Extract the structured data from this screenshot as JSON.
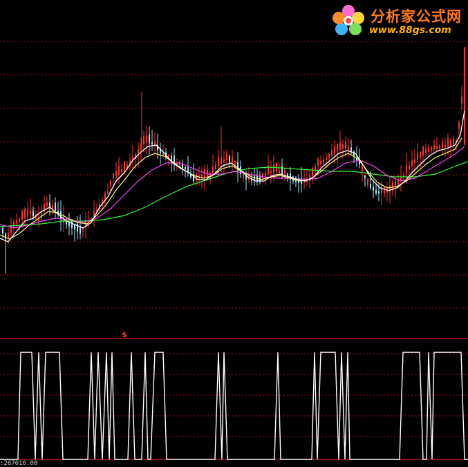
{
  "logo": {
    "name": "分析家公式网",
    "url": "www.88gs.com"
  },
  "footer": {
    "date_label": ":267016.00"
  },
  "marker": {
    "symbol": "$"
  },
  "colors": {
    "background": "#000000",
    "grid": "#a01010",
    "up_candle": "#ff3030",
    "down_candle": "#9fe8ff",
    "ma_short": "#ffffff",
    "ma_mid": "#ffff66",
    "ma_long": "#ff40ff",
    "ma_longest": "#30ff30",
    "signal": "#ffffff",
    "separator": "#ff2020"
  },
  "chart_data": [
    {
      "type": "candlestick",
      "title": "",
      "xlabel": "",
      "ylabel": "",
      "grid": true,
      "note": "Price panel with four moving averages",
      "close_path": [
        [
          0,
          330
        ],
        [
          10,
          350
        ],
        [
          22,
          325
        ],
        [
          32,
          318
        ],
        [
          44,
          310
        ],
        [
          56,
          320
        ],
        [
          68,
          298
        ],
        [
          80,
          305
        ],
        [
          92,
          322
        ],
        [
          104,
          330
        ],
        [
          116,
          338
        ],
        [
          128,
          325
        ],
        [
          140,
          308
        ],
        [
          152,
          290
        ],
        [
          164,
          258
        ],
        [
          176,
          250
        ],
        [
          188,
          240
        ],
        [
          200,
          225
        ],
        [
          210,
          205
        ],
        [
          222,
          210
        ],
        [
          232,
          222
        ],
        [
          244,
          232
        ],
        [
          256,
          240
        ],
        [
          268,
          245
        ],
        [
          280,
          262
        ],
        [
          292,
          258
        ],
        [
          304,
          255
        ],
        [
          316,
          240
        ],
        [
          328,
          232
        ],
        [
          340,
          240
        ],
        [
          352,
          258
        ],
        [
          364,
          262
        ],
        [
          376,
          264
        ],
        [
          388,
          252
        ],
        [
          400,
          248
        ],
        [
          412,
          255
        ],
        [
          424,
          262
        ],
        [
          436,
          266
        ],
        [
          448,
          262
        ],
        [
          460,
          240
        ],
        [
          472,
          232
        ],
        [
          484,
          222
        ],
        [
          496,
          215
        ],
        [
          508,
          220
        ],
        [
          520,
          238
        ],
        [
          532,
          268
        ],
        [
          544,
          280
        ],
        [
          556,
          280
        ],
        [
          568,
          276
        ],
        [
          580,
          262
        ],
        [
          592,
          245
        ],
        [
          604,
          232
        ],
        [
          616,
          222
        ],
        [
          628,
          216
        ],
        [
          640,
          214
        ],
        [
          652,
          212
        ],
        [
          662,
          205
        ],
        [
          668,
          150
        ],
        [
          672,
          95
        ]
      ],
      "ma_short": [
        [
          0,
          345
        ],
        [
          12,
          350
        ],
        [
          24,
          335
        ],
        [
          36,
          320
        ],
        [
          48,
          316
        ],
        [
          60,
          306
        ],
        [
          72,
          300
        ],
        [
          84,
          310
        ],
        [
          96,
          320
        ],
        [
          108,
          325
        ],
        [
          120,
          330
        ],
        [
          132,
          322
        ],
        [
          144,
          300
        ],
        [
          156,
          285
        ],
        [
          168,
          262
        ],
        [
          180,
          250
        ],
        [
          192,
          232
        ],
        [
          204,
          220
        ],
        [
          214,
          212
        ],
        [
          226,
          210
        ],
        [
          238,
          222
        ],
        [
          250,
          236
        ],
        [
          262,
          244
        ],
        [
          274,
          250
        ],
        [
          286,
          260
        ],
        [
          298,
          260
        ],
        [
          310,
          252
        ],
        [
          322,
          240
        ],
        [
          334,
          236
        ],
        [
          346,
          244
        ],
        [
          358,
          256
        ],
        [
          370,
          262
        ],
        [
          382,
          262
        ],
        [
          394,
          254
        ],
        [
          406,
          252
        ],
        [
          418,
          256
        ],
        [
          430,
          260
        ],
        [
          442,
          262
        ],
        [
          454,
          256
        ],
        [
          466,
          242
        ],
        [
          478,
          232
        ],
        [
          490,
          222
        ],
        [
          502,
          218
        ],
        [
          514,
          222
        ],
        [
          526,
          240
        ],
        [
          538,
          260
        ],
        [
          550,
          272
        ],
        [
          562,
          276
        ],
        [
          574,
          272
        ],
        [
          586,
          262
        ],
        [
          598,
          248
        ],
        [
          610,
          236
        ],
        [
          622,
          225
        ],
        [
          634,
          218
        ],
        [
          646,
          215
        ],
        [
          658,
          210
        ],
        [
          666,
          195
        ],
        [
          672,
          160
        ]
      ],
      "ma_mid": [
        [
          0,
          340
        ],
        [
          14,
          346
        ],
        [
          28,
          338
        ],
        [
          42,
          326
        ],
        [
          56,
          316
        ],
        [
          70,
          306
        ],
        [
          84,
          308
        ],
        [
          98,
          316
        ],
        [
          112,
          322
        ],
        [
          126,
          324
        ],
        [
          140,
          312
        ],
        [
          154,
          296
        ],
        [
          168,
          275
        ],
        [
          182,
          258
        ],
        [
          196,
          240
        ],
        [
          210,
          228
        ],
        [
          224,
          222
        ],
        [
          238,
          226
        ],
        [
          252,
          236
        ],
        [
          266,
          246
        ],
        [
          280,
          254
        ],
        [
          294,
          258
        ],
        [
          308,
          254
        ],
        [
          322,
          244
        ],
        [
          336,
          240
        ],
        [
          350,
          248
        ],
        [
          364,
          256
        ],
        [
          378,
          260
        ],
        [
          392,
          256
        ],
        [
          406,
          254
        ],
        [
          420,
          258
        ],
        [
          434,
          262
        ],
        [
          448,
          260
        ],
        [
          462,
          250
        ],
        [
          476,
          238
        ],
        [
          490,
          228
        ],
        [
          504,
          222
        ],
        [
          518,
          230
        ],
        [
          532,
          248
        ],
        [
          546,
          264
        ],
        [
          560,
          272
        ],
        [
          574,
          270
        ],
        [
          588,
          262
        ],
        [
          602,
          250
        ],
        [
          616,
          238
        ],
        [
          630,
          228
        ],
        [
          644,
          222
        ],
        [
          658,
          216
        ],
        [
          668,
          200
        ]
      ],
      "ma_long": [
        [
          0,
          325
        ],
        [
          20,
          330
        ],
        [
          40,
          326
        ],
        [
          60,
          320
        ],
        [
          80,
          316
        ],
        [
          100,
          318
        ],
        [
          120,
          322
        ],
        [
          140,
          316
        ],
        [
          160,
          302
        ],
        [
          180,
          282
        ],
        [
          200,
          262
        ],
        [
          220,
          246
        ],
        [
          240,
          236
        ],
        [
          260,
          236
        ],
        [
          280,
          244
        ],
        [
          300,
          252
        ],
        [
          320,
          252
        ],
        [
          340,
          248
        ],
        [
          360,
          252
        ],
        [
          380,
          256
        ],
        [
          400,
          258
        ],
        [
          420,
          258
        ],
        [
          440,
          260
        ],
        [
          460,
          258
        ],
        [
          480,
          248
        ],
        [
          500,
          236
        ],
        [
          520,
          232
        ],
        [
          540,
          240
        ],
        [
          560,
          254
        ],
        [
          580,
          262
        ],
        [
          600,
          258
        ],
        [
          620,
          246
        ],
        [
          640,
          234
        ],
        [
          660,
          222
        ],
        [
          672,
          212
        ]
      ],
      "ma_longest": [
        [
          0,
          328
        ],
        [
          30,
          326
        ],
        [
          60,
          324
        ],
        [
          90,
          320
        ],
        [
          120,
          320
        ],
        [
          150,
          318
        ],
        [
          180,
          312
        ],
        [
          210,
          300
        ],
        [
          240,
          284
        ],
        [
          270,
          270
        ],
        [
          300,
          260
        ],
        [
          330,
          250
        ],
        [
          360,
          244
        ],
        [
          390,
          242
        ],
        [
          420,
          244
        ],
        [
          450,
          246
        ],
        [
          480,
          248
        ],
        [
          510,
          248
        ],
        [
          540,
          252
        ],
        [
          570,
          256
        ],
        [
          600,
          256
        ],
        [
          630,
          252
        ],
        [
          660,
          240
        ],
        [
          677,
          234
        ]
      ]
    },
    {
      "type": "line",
      "title": "",
      "xlabel": "",
      "ylabel": "",
      "grid": true,
      "note": "Binary signal oscillator (1 = high, 0 = low)",
      "series": [
        {
          "values_by_x": [
            [
              0,
              0
            ],
            [
              26,
              0
            ],
            [
              30,
              1
            ],
            [
              46,
              1
            ],
            [
              51,
              0
            ],
            [
              56,
              1
            ],
            [
              61,
              0
            ],
            [
              66,
              1
            ],
            [
              86,
              1
            ],
            [
              91,
              0
            ],
            [
              127,
              0
            ],
            [
              132,
              1
            ],
            [
              137,
              0
            ],
            [
              142,
              1
            ],
            [
              148,
              0
            ],
            [
              154,
              1
            ],
            [
              158,
              0
            ],
            [
              162,
              1
            ],
            [
              166,
              0
            ],
            [
              185,
              0
            ],
            [
              190,
              1
            ],
            [
              195,
              0
            ],
            [
              205,
              0
            ],
            [
              210,
              1
            ],
            [
              214,
              0
            ],
            [
              218,
              0
            ],
            [
              224,
              1
            ],
            [
              236,
              1
            ],
            [
              241,
              0
            ],
            [
              311,
              0
            ],
            [
              316,
              1
            ],
            [
              321,
              0
            ],
            [
              324,
              1
            ],
            [
              329,
              0
            ],
            [
              397,
              0
            ],
            [
              402,
              1
            ],
            [
              406,
              0
            ],
            [
              451,
              0
            ],
            [
              455,
              1
            ],
            [
              459,
              0
            ],
            [
              464,
              1
            ],
            [
              485,
              1
            ],
            [
              490,
              0
            ],
            [
              494,
              1
            ],
            [
              499,
              0
            ],
            [
              503,
              1
            ],
            [
              506,
              0
            ],
            [
              578,
              0
            ],
            [
              583,
              1
            ],
            [
              607,
              1
            ],
            [
              612,
              0
            ],
            [
              617,
              0
            ],
            [
              620,
              1
            ],
            [
              625,
              0
            ],
            [
              628,
              1
            ],
            [
              667,
              1
            ],
            [
              672,
              0
            ],
            [
              677,
              0
            ]
          ]
        }
      ]
    }
  ]
}
